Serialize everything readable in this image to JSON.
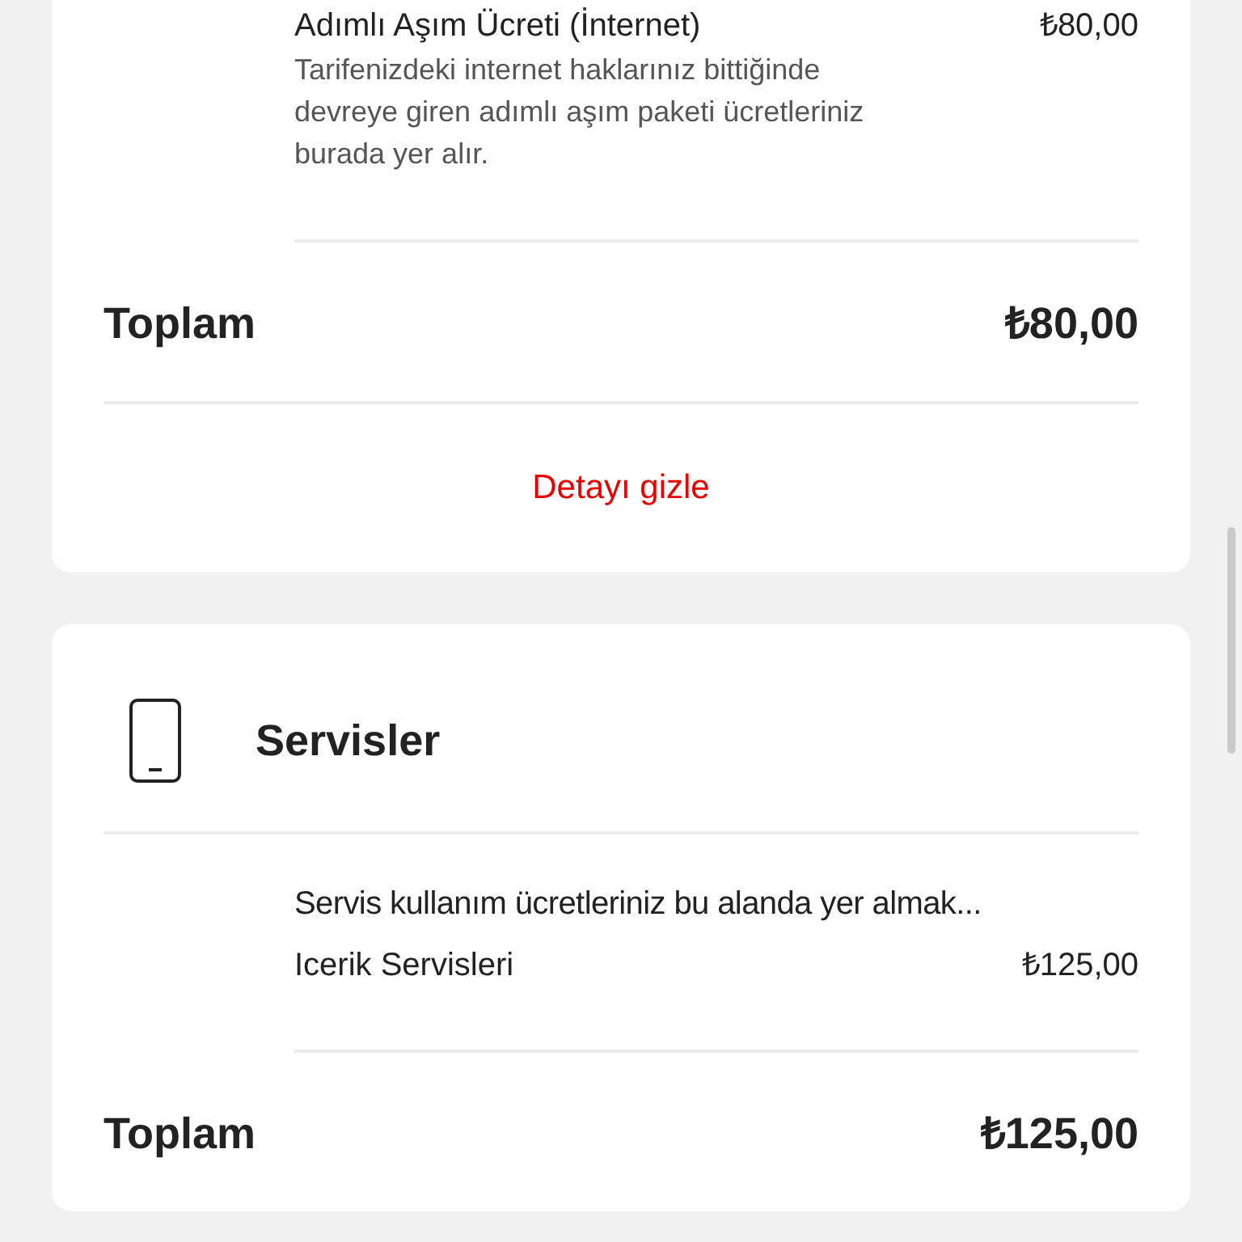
{
  "cards": [
    {
      "items": [
        {
          "name": "Adımlı Aşım Ücreti (İnternet)",
          "price": "₺80,00",
          "description": "Tarifenizdeki internet haklarınız bittiğinde devreye giren adımlı aşım paketi ücretleriniz burada yer alır."
        }
      ],
      "total_label": "Toplam",
      "total": "₺80,00",
      "link": "Detayı gizle"
    },
    {
      "title": "Servisler",
      "note": "Servis kullanım ücretleriniz bu alanda yer almak...",
      "items": [
        {
          "name": "Icerik Servisleri",
          "price": "₺125,00"
        }
      ],
      "total_label": "Toplam",
      "total": "₺125,00"
    }
  ]
}
